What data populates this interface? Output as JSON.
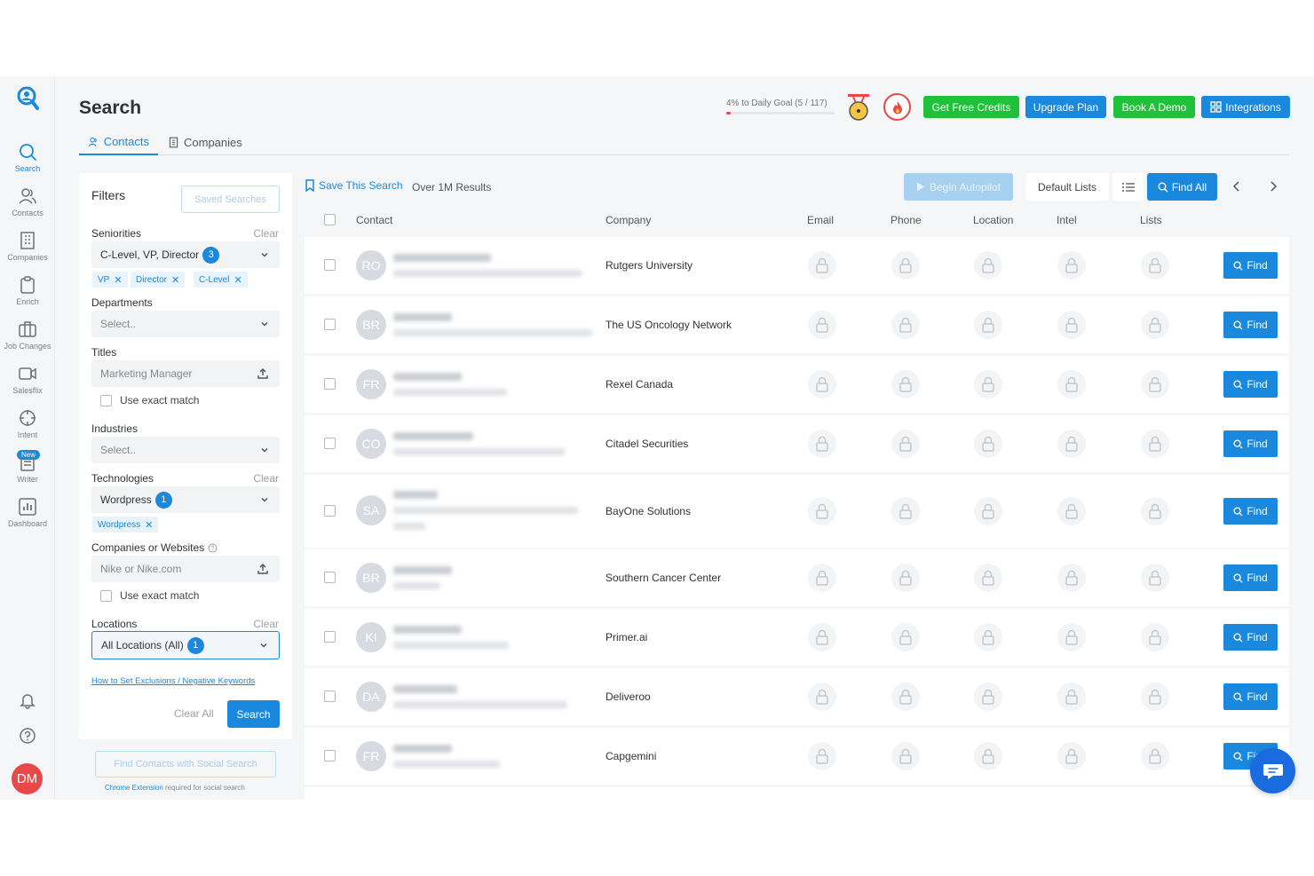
{
  "nav": {
    "items": [
      {
        "label": "Search",
        "icon": "search-icon"
      },
      {
        "label": "Contacts",
        "icon": "contacts-icon"
      },
      {
        "label": "Companies",
        "icon": "companies-icon"
      },
      {
        "label": "Enrich",
        "icon": "clipboard-icon"
      },
      {
        "label": "Job Changes",
        "icon": "briefcase-icon"
      },
      {
        "label": "Salesflix",
        "icon": "video-icon"
      },
      {
        "label": "Intent",
        "icon": "crosshair-icon"
      },
      {
        "label": "Writer",
        "icon": "document-icon"
      },
      {
        "label": "Dashboard",
        "icon": "chart-icon"
      }
    ],
    "new_badge": "New",
    "avatar": "DM"
  },
  "header": {
    "title": "Search",
    "tabs": [
      "Contacts",
      "Companies"
    ],
    "goal_text": "4% to Daily Goal (5 / 117)",
    "goal_progress": 0.04,
    "buttons": {
      "free_credits": "Get Free Credits",
      "upgrade": "Upgrade Plan",
      "demo": "Book A Demo",
      "integrations": "Integrations"
    }
  },
  "filters": {
    "title": "Filters",
    "saved_searches": "Saved Searches",
    "clear": "Clear",
    "seniorities": {
      "label": "Seniorities",
      "value": "C-Level, VP, Director",
      "count": "3",
      "chips": [
        "VP",
        "Director",
        "C-Level"
      ]
    },
    "departments": {
      "label": "Departments",
      "placeholder": "Select.."
    },
    "titles": {
      "label": "Titles",
      "placeholder": "Marketing Manager",
      "exact": "Use exact match"
    },
    "industries": {
      "label": "Industries",
      "placeholder": "Select.."
    },
    "technologies": {
      "label": "Technologies",
      "value": "Wordpress",
      "count": "1",
      "chips": [
        "Wordpress"
      ]
    },
    "companies": {
      "label": "Companies or Websites",
      "placeholder": "Nike or Nike.com",
      "exact": "Use exact match"
    },
    "locations": {
      "label": "Locations",
      "value": "All Locations (All)",
      "count": "1"
    },
    "exclusions_link": "How to Set Exclusions / Negative Keywords",
    "clear_all": "Clear All",
    "search": "Search",
    "social_search": "Find Contacts with Social Search",
    "chrome_ext": "Chrome Extension",
    "chrome_note": " required for social search"
  },
  "results": {
    "save_search": "Save This Search",
    "count": "Over 1M Results",
    "autopilot": "Begin Autopilot",
    "default_lists": "Default Lists",
    "find_all": "Find All",
    "columns": [
      "Contact",
      "Company",
      "Email",
      "Phone",
      "Location",
      "Intel",
      "Lists"
    ],
    "find_label": "Find",
    "rows": [
      {
        "initials": "RO",
        "company": "Rutgers University"
      },
      {
        "initials": "BR",
        "company": "The US Oncology Network"
      },
      {
        "initials": "FR",
        "company": "Rexel Canada"
      },
      {
        "initials": "CO",
        "company": "Citadel Securities"
      },
      {
        "initials": "SA",
        "company": "BayOne Solutions"
      },
      {
        "initials": "BR",
        "company": "Southern Cancer Center"
      },
      {
        "initials": "KI",
        "company": "Primer.ai"
      },
      {
        "initials": "DA",
        "company": "Deliveroo"
      },
      {
        "initials": "FR",
        "company": "Capgemini"
      }
    ]
  },
  "colors": {
    "accent": "#1a88dd",
    "green": "#1fc13a",
    "red": "#e84848"
  }
}
